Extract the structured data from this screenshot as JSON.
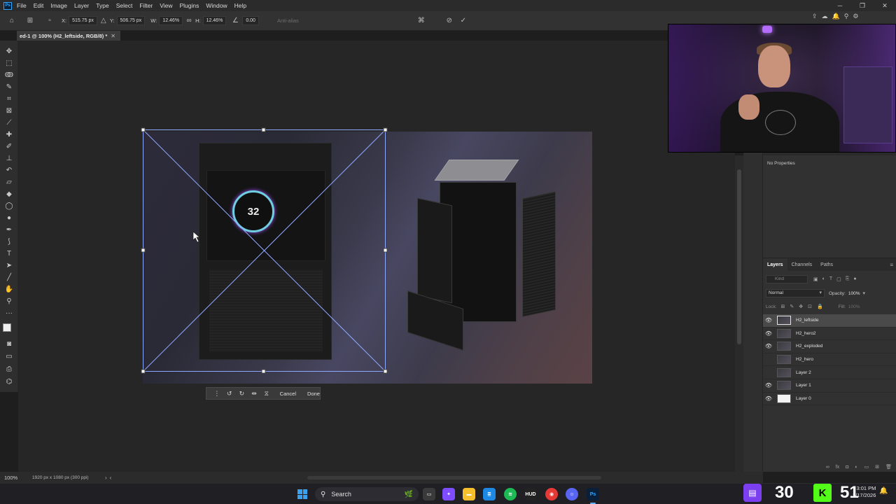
{
  "menubar": {
    "logo": "Ps",
    "items": [
      "File",
      "Edit",
      "Image",
      "Layer",
      "Type",
      "Select",
      "Filter",
      "View",
      "Plugins",
      "Window",
      "Help"
    ],
    "window_controls": [
      "─",
      "❐",
      "✕"
    ]
  },
  "options": {
    "x_label": "X:",
    "x_value": "515.75 px",
    "y_label": "Y:",
    "y_value": "506.75 px",
    "w_label": "W:",
    "w_value": "12.46%",
    "h_label": "H:",
    "h_value": "12.46%",
    "angle_value": "0.00",
    "interpolation": "Anti-alias"
  },
  "document": {
    "tab_title": "ed-1 @ 100% (H2_leftside, RGB/8) *",
    "zoom": "100%",
    "info": "1920 px x 1080 px (300 ppi)"
  },
  "canvas": {
    "lcd_value": "32"
  },
  "transform_bar": {
    "cancel_label": "Cancel",
    "done_label": "Done"
  },
  "properties": {
    "empty_label": "No Properties"
  },
  "layers_panel": {
    "tabs": [
      "Layers",
      "Channels",
      "Paths"
    ],
    "kind_placeholder": "Kind",
    "blend_mode": "Normal",
    "opacity_label": "Opacity:",
    "opacity_value": "100%",
    "lock_label": "Lock:",
    "fill_label": "Fill:",
    "fill_value": "100%",
    "layers": [
      {
        "name": "H2_leftside",
        "visible": true,
        "selected": true
      },
      {
        "name": "H2_hero2",
        "visible": true,
        "selected": false
      },
      {
        "name": "H2_exploded",
        "visible": true,
        "selected": false
      },
      {
        "name": "H2_hero",
        "visible": false,
        "selected": false
      },
      {
        "name": "Layer 2",
        "visible": false,
        "selected": false
      },
      {
        "name": "Layer 1",
        "visible": true,
        "selected": false
      },
      {
        "name": "Layer 0",
        "visible": true,
        "selected": false
      }
    ]
  },
  "taskbar": {
    "search_label": "Search",
    "twitch_count": "30",
    "kick_count": "51",
    "time": "3:01 PM",
    "date": "2/17/2026"
  },
  "colors": {
    "accent": "#31a8ff",
    "twitch": "#7b3ff0",
    "kick": "#53fc18",
    "transform_handle": "#8fa8ff"
  }
}
